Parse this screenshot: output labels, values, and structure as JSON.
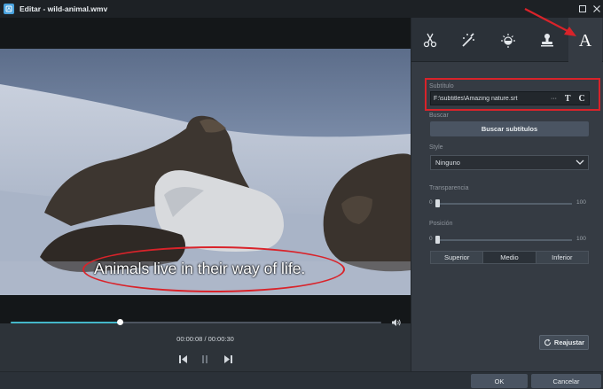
{
  "window": {
    "title": "Editar - wild-animal.wmv"
  },
  "video": {
    "subtitle_overlay": "Animals live in their way of life.",
    "time_current": "00:00:08",
    "time_separator": " / ",
    "time_total": "00:00:30",
    "progress": 0.295
  },
  "tools": {
    "tabs": [
      "scissors-icon",
      "magic-wand-icon",
      "brightness-icon",
      "stamp-icon",
      "text-icon"
    ],
    "active": "text-icon"
  },
  "subtitle_panel": {
    "subtitle_label": "Subtítulo",
    "subtitle_path": "F:\\subtitles\\Amazing nature.srt",
    "more_label": "···",
    "font_label": "T",
    "color_label": "C",
    "search_label": "Buscar",
    "search_button": "Buscar subtítulos",
    "style_label": "Style",
    "style_value": "Ninguno",
    "transparency_label": "Transparencia",
    "transparency_min": "0",
    "transparency_max": "100",
    "transparency_value": 0,
    "position_label": "Posición",
    "position_min": "0",
    "position_max": "100",
    "position_value": 0,
    "positions": [
      "Superior",
      "Medio",
      "Inferior"
    ],
    "position_selected": "Medio",
    "reset_button": "Reajustar"
  },
  "footer": {
    "ok_button": "OK",
    "cancel_button": "Cancelar"
  },
  "colors": {
    "accent": "#44b7c9",
    "highlight_red": "#d9232a",
    "panel": "#353b43"
  }
}
